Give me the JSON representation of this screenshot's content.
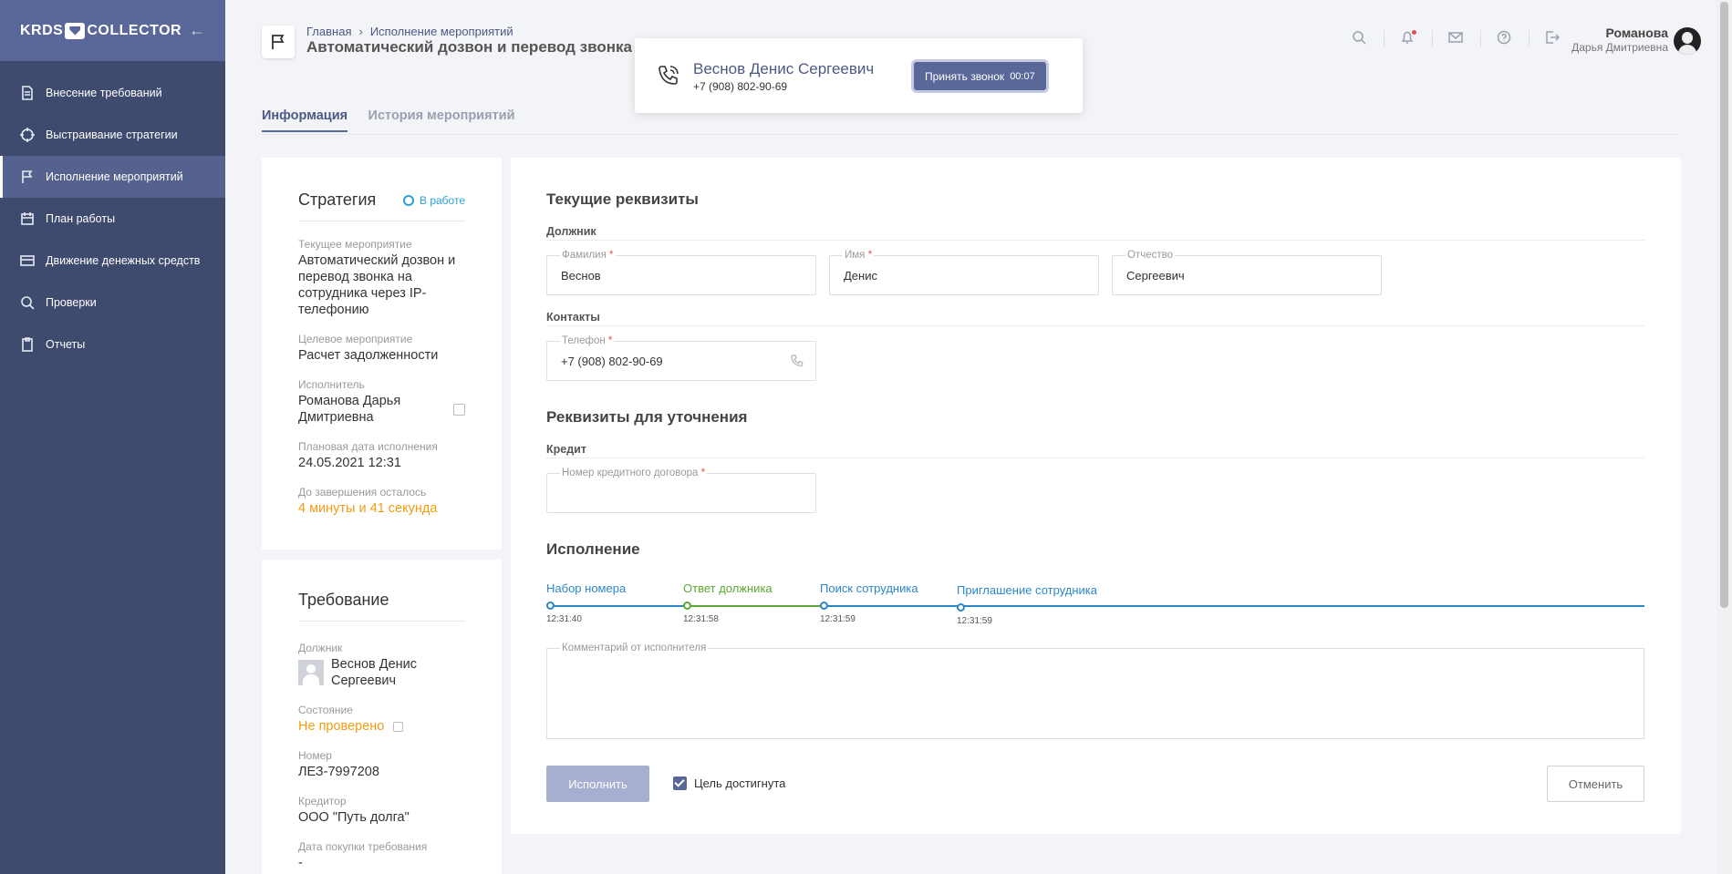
{
  "brand": {
    "logo_left": "KRDS",
    "logo_right": "COLLECTOR"
  },
  "sidebar": {
    "items": [
      {
        "label": "Внесение требований",
        "icon": "document-icon"
      },
      {
        "label": "Выстраивание стратегии",
        "icon": "target-icon"
      },
      {
        "label": "Исполнение мероприятий",
        "icon": "flag-icon",
        "active": true
      },
      {
        "label": "План работы",
        "icon": "calendar-icon"
      },
      {
        "label": "Движение денежных средств",
        "icon": "card-icon"
      },
      {
        "label": "Проверки",
        "icon": "search-icon"
      },
      {
        "label": "Отчеты",
        "icon": "clipboard-icon"
      }
    ]
  },
  "header": {
    "breadcrumb": [
      "Главная",
      "Исполнение мероприятий"
    ],
    "title": "Автоматический дозвон и перевод звонка",
    "user_surname": "Романова",
    "user_name": "Дарья Дмитриевна"
  },
  "call": {
    "name": "Веснов Денис Сергеевич",
    "phone": "+7 (908) 802-90-69",
    "accept_label": "Принять звонок",
    "timer": "00:07"
  },
  "tabs": [
    {
      "label": "Информация",
      "active": true
    },
    {
      "label": "История мероприятий",
      "active": false
    }
  ],
  "strategy": {
    "title": "Стратегия",
    "status": "В работе",
    "current_label": "Текущее мероприятие",
    "current_value": "Автоматический дозвон и перевод звонка на сотрудника через IP-телефонию",
    "target_label": "Целевое мероприятие",
    "target_value": "Расчет задолженности",
    "executor_label": "Исполнитель",
    "executor_value": "Романова Дарья Дмитриевна",
    "planned_label": "Плановая дата исполнения",
    "planned_value": "24.05.2021 12:31",
    "remaining_label": "До завершения осталось",
    "remaining_value": "4 минуты и 41 секунда"
  },
  "requirement": {
    "title": "Требование",
    "debtor_label": "Должник",
    "debtor_value": "Веснов Денис Сергеевич",
    "state_label": "Состояние",
    "state_value": "Не проверено",
    "number_label": "Номер",
    "number_value": "ЛЕЗ-7997208",
    "creditor_label": "Кредитор",
    "creditor_value": "ООО \"Путь долга\"",
    "purchase_label": "Дата покупки требования",
    "purchase_value": "-"
  },
  "main": {
    "current_title": "Текущие реквизиты",
    "debtor_sub": "Должник",
    "surname_label": "Фамилия",
    "surname_value": "Веснов",
    "name_label": "Имя",
    "name_value": "Денис",
    "patronymic_label": "Отчество",
    "patronymic_value": "Сергеевич",
    "contacts_sub": "Контакты",
    "phone_label": "Телефон",
    "phone_value": "+7 (908) 802-90-69",
    "clarify_title": "Реквизиты для уточнения",
    "credit_sub": "Кредит",
    "contract_label": "Номер кредитного договора",
    "contract_value": "",
    "exec_title": "Исполнение",
    "comment_label": "Комментарий от исполнителя",
    "exec_button": "Исполнить",
    "goal_label": "Цель достигнута",
    "cancel_button": "Отменить",
    "required_mark": "*"
  },
  "timeline": [
    {
      "name": "Набор номера",
      "time": "12:31:40",
      "color": "#2b88c8"
    },
    {
      "name": "Ответ должника",
      "time": "12:31:58",
      "color": "#5aa832"
    },
    {
      "name": "Поиск сотрудника",
      "time": "12:31:59",
      "color": "#2b88c8"
    },
    {
      "name": "Приглашение сотрудника",
      "time": "12:31:59",
      "color": "#2b88c8"
    }
  ]
}
